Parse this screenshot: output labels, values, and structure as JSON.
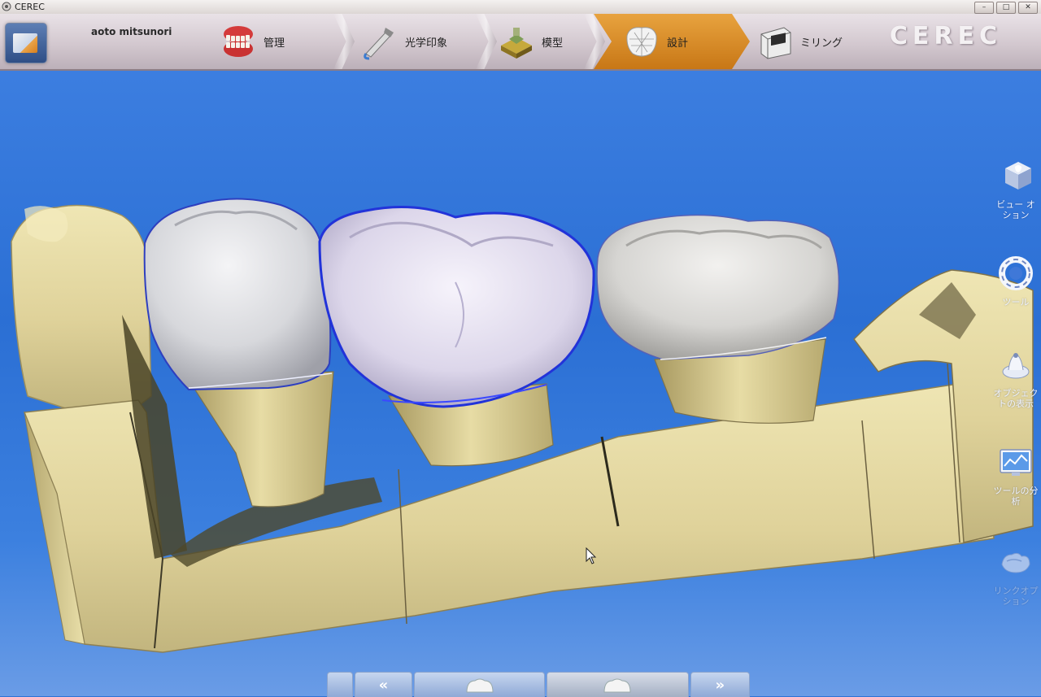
{
  "window": {
    "title": "CEREC",
    "controls": [
      "–",
      "□",
      "✕"
    ]
  },
  "toolbar": {
    "user_name": "aoto mitsunori",
    "phases": [
      {
        "label": "管理",
        "icon": "denture-icon",
        "active": false
      },
      {
        "label": "光学印象",
        "icon": "camera-wand-icon",
        "active": false
      },
      {
        "label": "模型",
        "icon": "model-icon",
        "active": false
      },
      {
        "label": "設計",
        "icon": "crown-design-icon",
        "active": true
      },
      {
        "label": "ミリング",
        "icon": "milling-unit-icon",
        "active": false
      }
    ],
    "brand": "CEREC",
    "active_color": "#d98a26"
  },
  "right_panel": {
    "items": [
      {
        "label": "ビュー オ\nション",
        "icon": "view-cube-icon",
        "enabled": true
      },
      {
        "label": "ツール",
        "icon": "tools-ring-icon",
        "enabled": true
      },
      {
        "label": "オブジェク\nトの表示",
        "icon": "object-display-icon",
        "enabled": true
      },
      {
        "label": "ツールの分\n析",
        "icon": "analysis-monitor-icon",
        "enabled": true
      },
      {
        "label": "リンクオプ\nション",
        "icon": "link-options-icon",
        "enabled": false
      }
    ]
  },
  "bottom_nav": {
    "prev": "«",
    "next": "»"
  },
  "viewport": {
    "background": "#2f73d6"
  }
}
